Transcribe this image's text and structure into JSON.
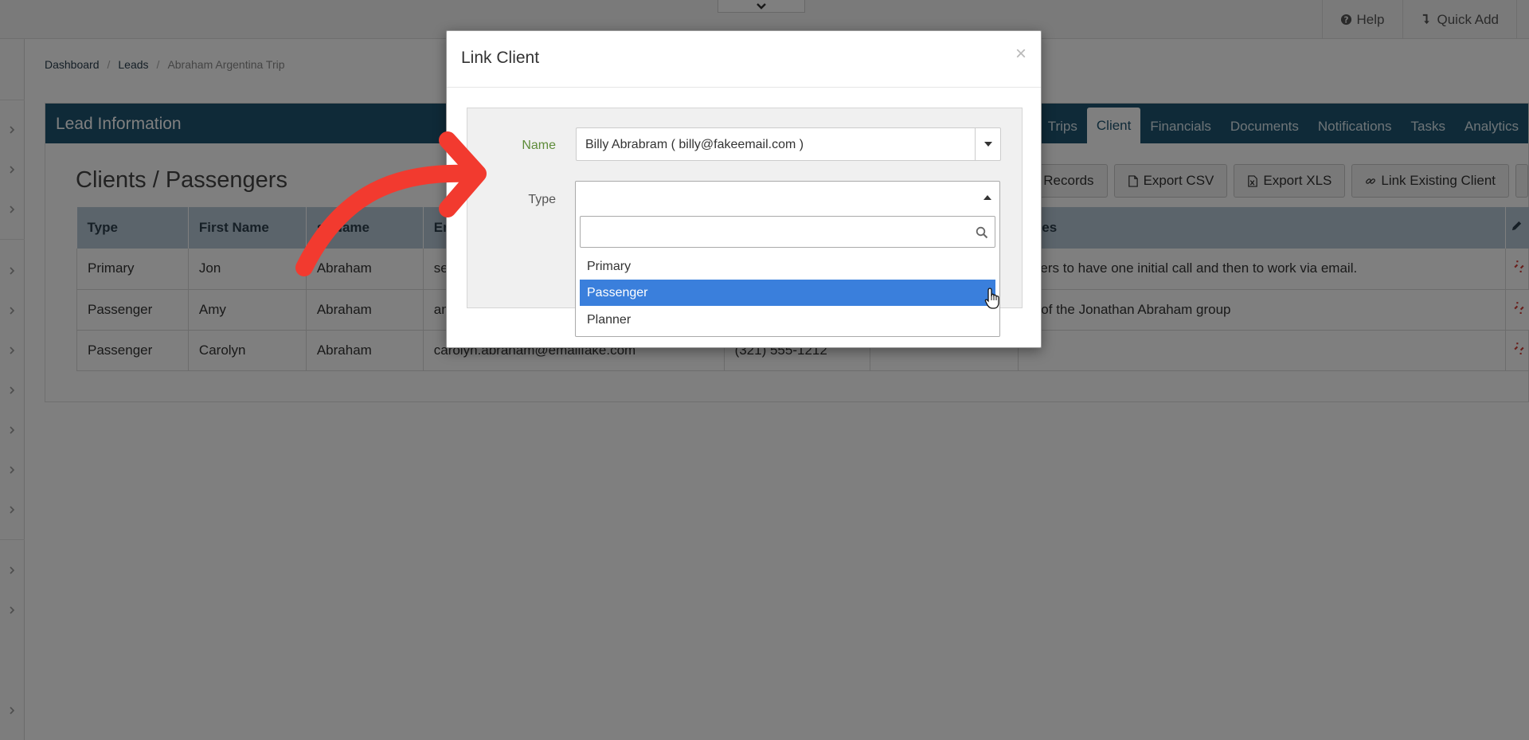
{
  "topbar": {
    "help_label": "Help",
    "quick_add_label": "Quick Add"
  },
  "breadcrumb": {
    "dashboard": "Dashboard",
    "leads": "Leads",
    "current": "Abraham Argentina Trip",
    "separator": "/"
  },
  "panel": {
    "title": "Lead Information",
    "tabs": [
      "Trips",
      "Client",
      "Financials",
      "Documents",
      "Notifications",
      "Tasks",
      "Analytics"
    ],
    "active_tab": "Client",
    "section_title": "Clients / Passengers",
    "buttons": {
      "client_records": "ient Records",
      "export_csv": "Export CSV",
      "export_xls": "Export XLS",
      "link_existing": "Link Existing Client"
    },
    "columns": [
      "Type",
      "First Name",
      "st Name",
      "Em",
      "",
      "",
      "otes"
    ],
    "rows": [
      {
        "type": "Primary",
        "first": "Jon",
        "last": "Abraham",
        "email": "se",
        "phone": "",
        "extra": "",
        "notes": "efers to have one initial call and then to work via email."
      },
      {
        "type": "Passenger",
        "first": "Amy",
        "last": "Abraham",
        "email": "an",
        "phone": "",
        "extra": "",
        "notes": "rt of the Jonathan Abraham group"
      },
      {
        "type": "Passenger",
        "first": "Carolyn",
        "last": "Abraham",
        "email": "carolyn.abraham@emailfake.com",
        "phone": "(321) 555-1212",
        "extra": "",
        "notes": ""
      }
    ]
  },
  "modal": {
    "title": "Link Client",
    "close_symbol": "×",
    "name_label": "Name",
    "name_value": "Billy Abrabram ( billy@fakeemail.com )",
    "type_label": "Type",
    "search_value": "",
    "options": [
      "Primary",
      "Passenger",
      "Planner"
    ],
    "highlighted_option": "Passenger"
  },
  "colors": {
    "panel_header": "#1f5570",
    "highlight": "#3a7fdc",
    "annotation_arrow": "#f23a2f",
    "name_label": "#5e8c3a"
  }
}
